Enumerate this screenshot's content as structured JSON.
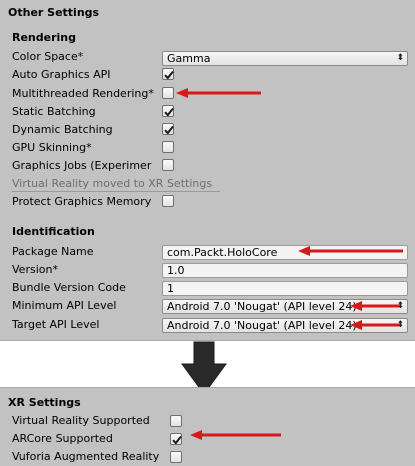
{
  "other_settings": {
    "title": "Other Settings",
    "rendering": {
      "header": "Rendering",
      "color_space_label": "Color Space*",
      "color_space_value": "Gamma",
      "auto_graphics_api_label": "Auto Graphics API",
      "auto_graphics_api_checked": true,
      "multithreaded_rendering_label": "Multithreaded Rendering*",
      "multithreaded_rendering_checked": false,
      "static_batching_label": "Static Batching",
      "static_batching_checked": true,
      "dynamic_batching_label": "Dynamic Batching",
      "dynamic_batching_checked": true,
      "gpu_skinning_label": "GPU Skinning*",
      "gpu_skinning_checked": false,
      "graphics_jobs_label": "Graphics Jobs (Experimer",
      "graphics_jobs_checked": false,
      "vr_moved_note": "Virtual Reality moved to XR Settings",
      "protect_graphics_memory_label": "Protect Graphics Memory",
      "protect_graphics_memory_checked": false
    },
    "identification": {
      "header": "Identification",
      "package_name_label": "Package Name",
      "package_name_value": "com.Packt.HoloCore",
      "version_label": "Version*",
      "version_value": "1.0",
      "bundle_version_code_label": "Bundle Version Code",
      "bundle_version_code_value": "1",
      "min_api_level_label": "Minimum API Level",
      "min_api_level_value": "Android 7.0 'Nougat' (API level 24)",
      "target_api_level_label": "Target API Level",
      "target_api_level_value": "Android 7.0 'Nougat' (API level 24)"
    }
  },
  "xr_settings": {
    "title": "XR Settings",
    "vr_supported_label": "Virtual Reality Supported",
    "vr_supported_checked": false,
    "arcore_supported_label": "ARCore Supported",
    "arcore_supported_checked": true,
    "vuforia_label": "Vuforia Augmented Reality",
    "vuforia_checked": false
  },
  "icons": {
    "dropdown_caret": "chevron-updown-icon",
    "checkmark": "checkmark-icon",
    "annotation_arrow": "red-arrow-icon",
    "transition_arrow": "down-arrow-icon"
  },
  "colors": {
    "panel_bg": "#c2c2c2",
    "annotation_arrow": "#d41a1a",
    "transition_arrow": "#2a2a2a"
  }
}
